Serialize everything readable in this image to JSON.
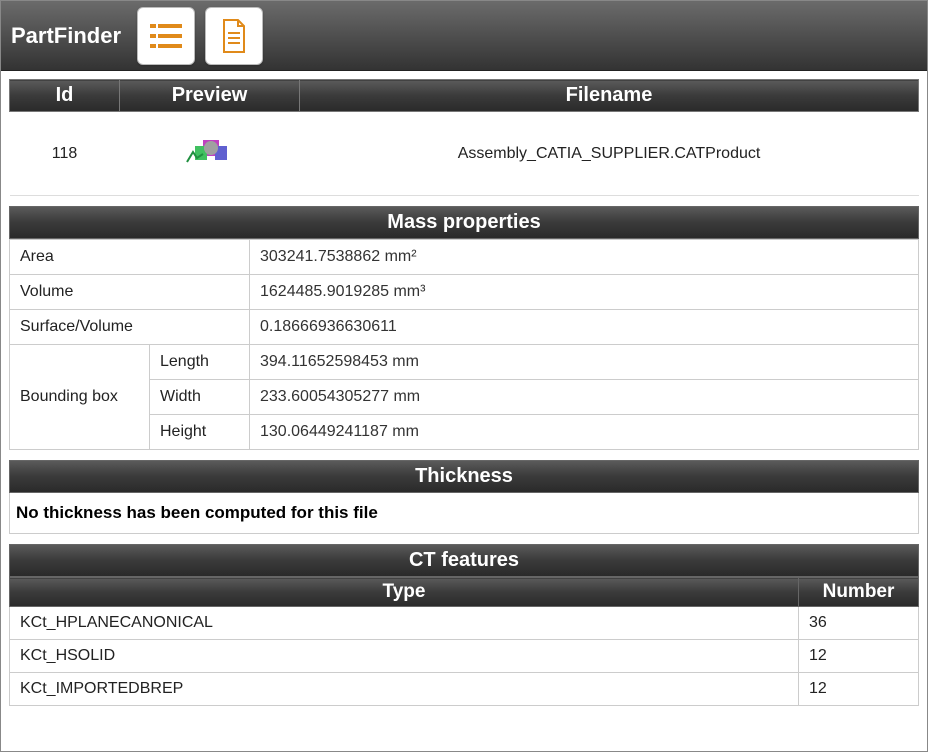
{
  "app": {
    "title": "PartFinder"
  },
  "file_head": {
    "cols": {
      "id": "Id",
      "preview": "Preview",
      "filename": "Filename"
    },
    "row": {
      "id": "118",
      "filename": "Assembly_CATIA_SUPPLIER.CATProduct"
    }
  },
  "sections": {
    "mass_title": "Mass properties",
    "thickness_title": "Thickness",
    "ct_title": "CT features"
  },
  "mass": {
    "area_label": "Area",
    "area_val": "303241.7538862 mm²",
    "volume_label": "Volume",
    "volume_val": "1624485.9019285 mm³",
    "sv_label": "Surface/Volume",
    "sv_val": "0.18666936630611",
    "bbox_label": "Bounding box",
    "length_label": "Length",
    "length_val": "394.11652598453 mm",
    "width_label": "Width",
    "width_val": "233.60054305277 mm",
    "height_label": "Height",
    "height_val": "130.06449241187 mm"
  },
  "thickness": {
    "note": "No thickness has been computed for this file"
  },
  "ct": {
    "type_header": "Type",
    "number_header": "Number",
    "rows": [
      {
        "type": "KCt_HPLANECANONICAL",
        "number": "36"
      },
      {
        "type": "KCt_HSOLID",
        "number": "12"
      },
      {
        "type": "KCt_IMPORTEDBREP",
        "number": "12"
      }
    ]
  }
}
